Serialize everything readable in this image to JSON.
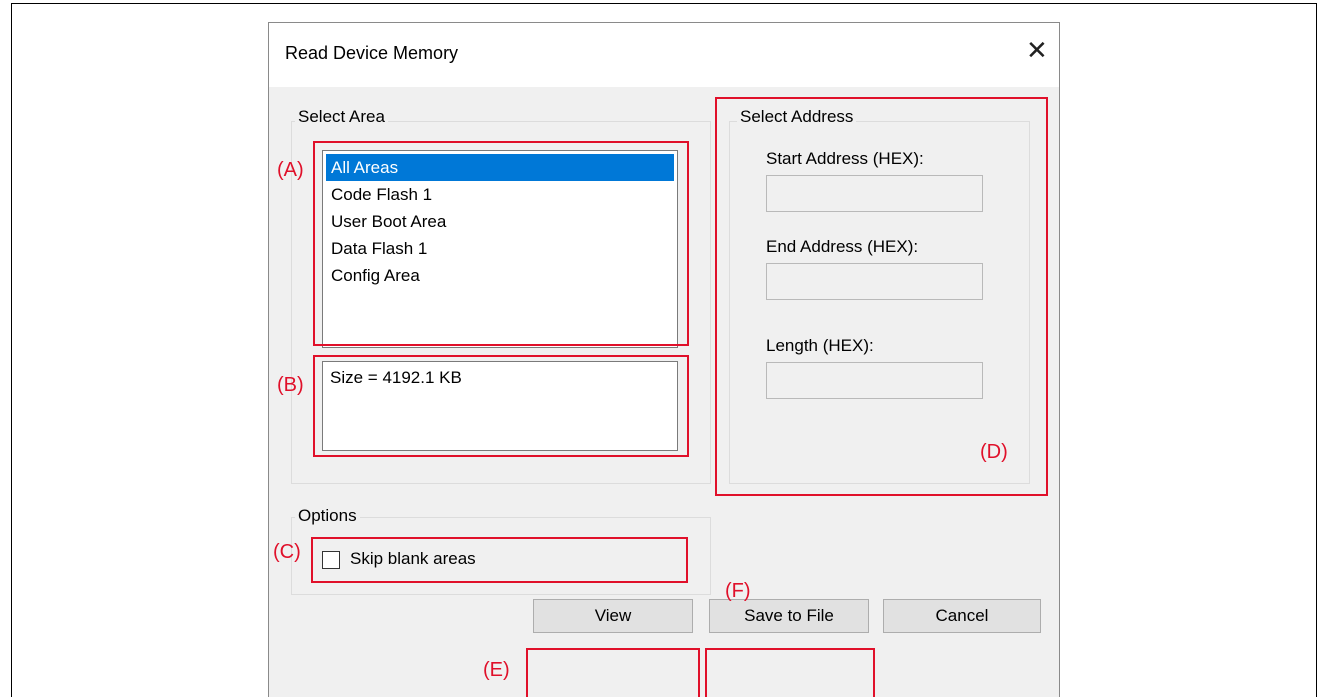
{
  "dialog": {
    "title": "Read Device Memory"
  },
  "select_area": {
    "label": "Select Area",
    "items": [
      "All Areas",
      "Code Flash 1",
      "User Boot Area",
      "Data Flash 1",
      "Config Area"
    ],
    "selected": "All Areas",
    "size_text": "Size = 4192.1 KB"
  },
  "select_address": {
    "label": "Select Address",
    "start_label": "Start Address (HEX):",
    "end_label": "End Address (HEX):",
    "length_label": "Length (HEX):",
    "start_value": "",
    "end_value": "",
    "length_value": ""
  },
  "options": {
    "label": "Options",
    "skip_blank_label": "Skip blank areas",
    "skip_blank_checked": false
  },
  "buttons": {
    "view": "View",
    "save": "Save to File",
    "cancel": "Cancel"
  },
  "callouts": {
    "a": "(A)",
    "b": "(B)",
    "c": "(C)",
    "d": "(D)",
    "e": "(E)",
    "f": "(F)"
  },
  "colors": {
    "accent": "#e0102a",
    "selection": "#0078d7"
  }
}
